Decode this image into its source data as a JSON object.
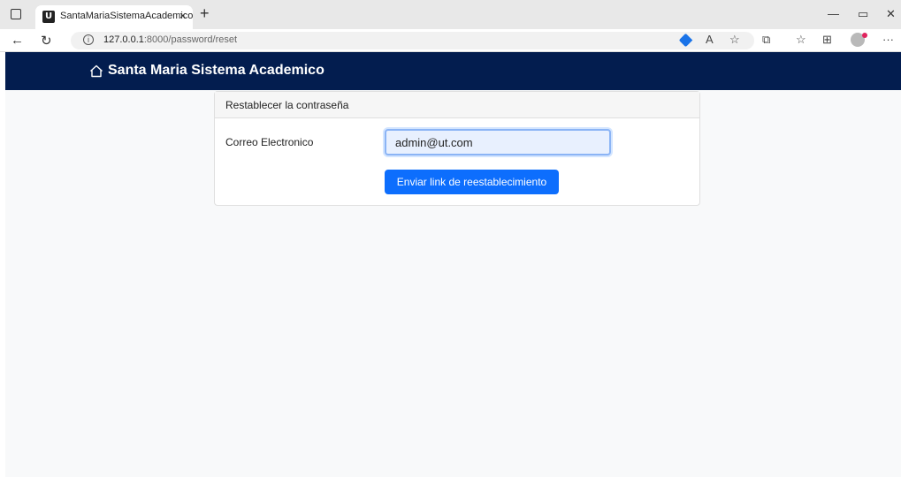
{
  "browser": {
    "tab_title": "SantaMariaSistemaAcademico",
    "tab_favicon": "U",
    "tab_close": "×",
    "new_tab": "+",
    "url_host": "127.0.0.1",
    "url_path": ":8000/password/reset",
    "icons": [
      "tab-actions-icon",
      "back-arrow-icon",
      "refresh-icon",
      "site-info-icon",
      "tag-icon",
      "read-aloud-icon",
      "favorite-add-icon",
      "extensions-icon",
      "favorites-icon",
      "collections-icon",
      "profile-avatar",
      "more-icon",
      "minimize-icon",
      "restore-icon",
      "close-icon"
    ]
  },
  "navbar": {
    "brand": "Santa Maria Sistema Academico",
    "brand_icon": "home-icon",
    "color": "#031d4f"
  },
  "card": {
    "header": "Restablecer la contraseña",
    "email_label": "Correo Electronico",
    "email_value": "admin@ut.com",
    "submit_label": "Enviar link de reestablecimiento",
    "button_color": "#0d6efd"
  }
}
